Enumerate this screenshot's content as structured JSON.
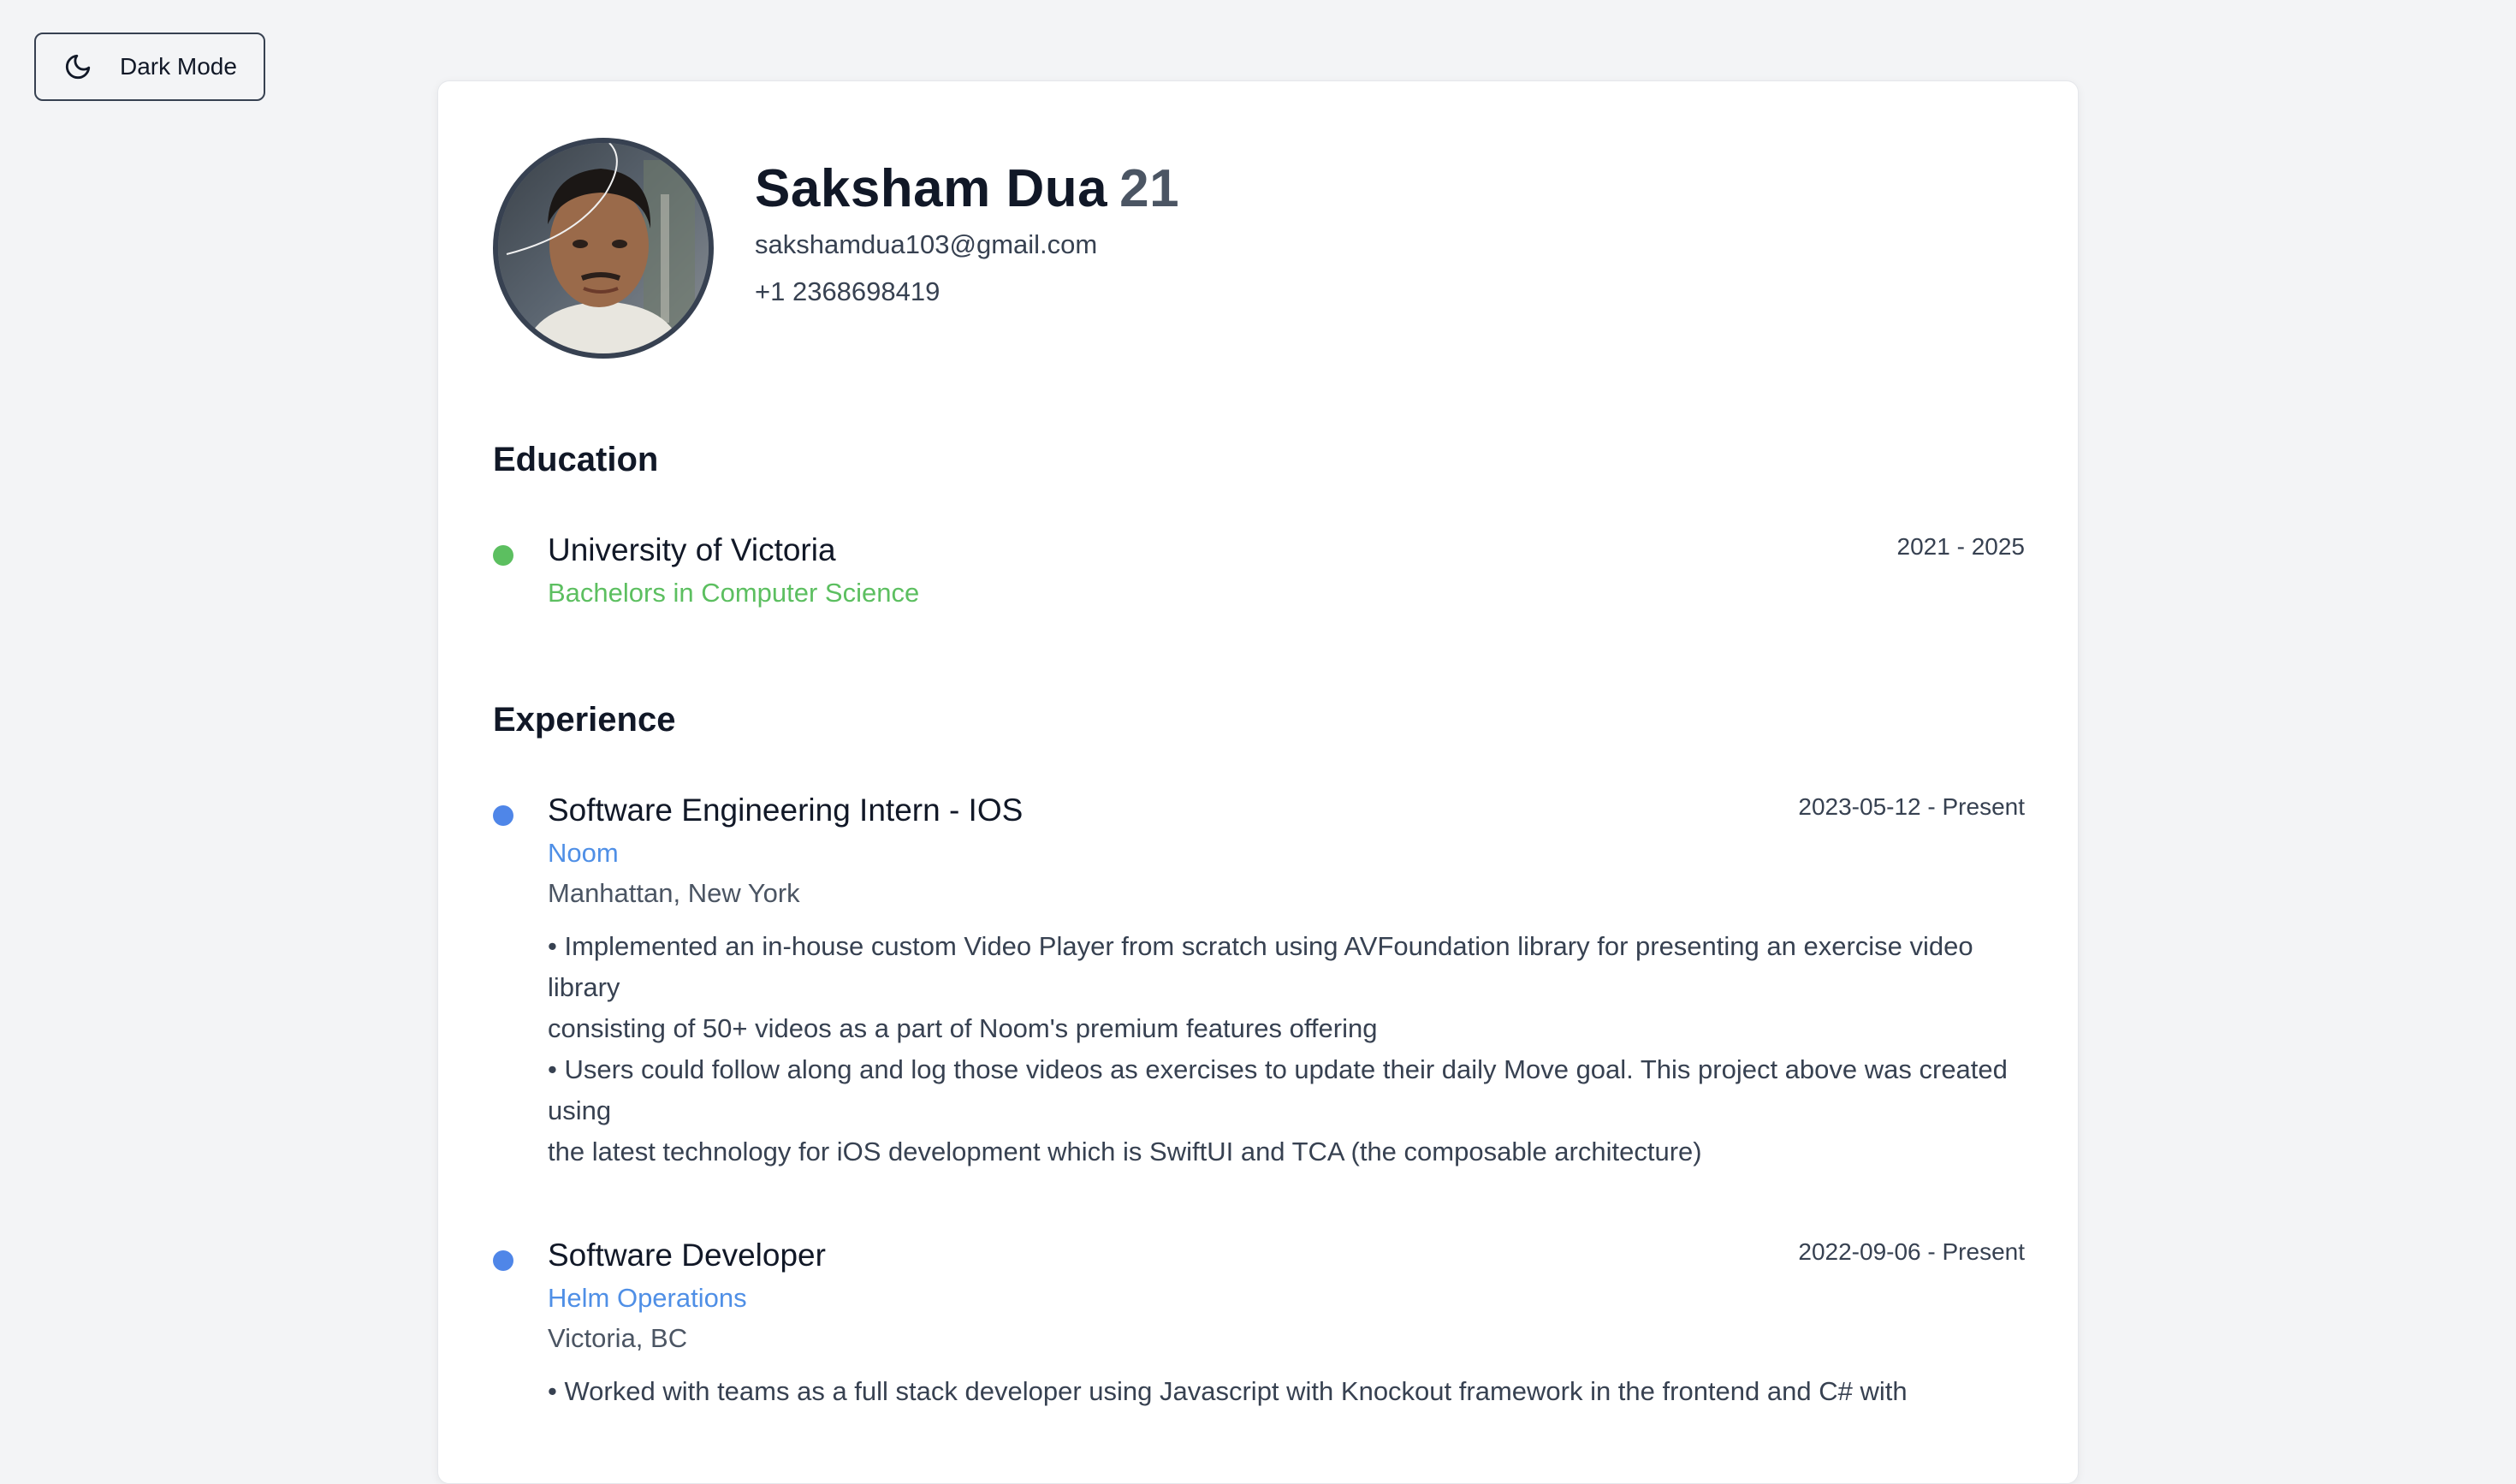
{
  "toolbar": {
    "dark_mode_label": "Dark Mode",
    "icon": "moon-icon"
  },
  "profile": {
    "name": "Saksham Dua",
    "age": "21",
    "email": "sakshamdua103@gmail.com",
    "phone": "+1 2368698419"
  },
  "education": {
    "heading": "Education",
    "items": [
      {
        "school": "University of Victoria",
        "degree": "Bachelors in Computer Science",
        "dates": "2021 - 2025"
      }
    ]
  },
  "experience": {
    "heading": "Experience",
    "items": [
      {
        "title": "Software Engineering Intern - IOS",
        "company": "Noom",
        "location": "Manhattan, New York",
        "dates": "2023-05-12 - Present",
        "description": "• Implemented an in-house custom Video Player from scratch using AVFoundation library for presenting an exercise video library\nconsisting of 50+ videos as a part of Noom's premium features offering\n• Users could follow along and log those videos as exercises to update their daily Move goal. This project above was created using\nthe latest technology for iOS development which is SwiftUI and TCA (the composable architecture)"
      },
      {
        "title": "Software Developer",
        "company": "Helm Operations",
        "location": "Victoria, BC",
        "dates": "2022-09-06 - Present",
        "description": "• Worked with teams as a full stack developer using Javascript with Knockout framework in the frontend and C# with"
      }
    ]
  },
  "colors": {
    "education_accent": "#5cbf60",
    "experience_accent": "#4f86e8",
    "background": "#f3f4f6",
    "card": "#ffffff"
  }
}
